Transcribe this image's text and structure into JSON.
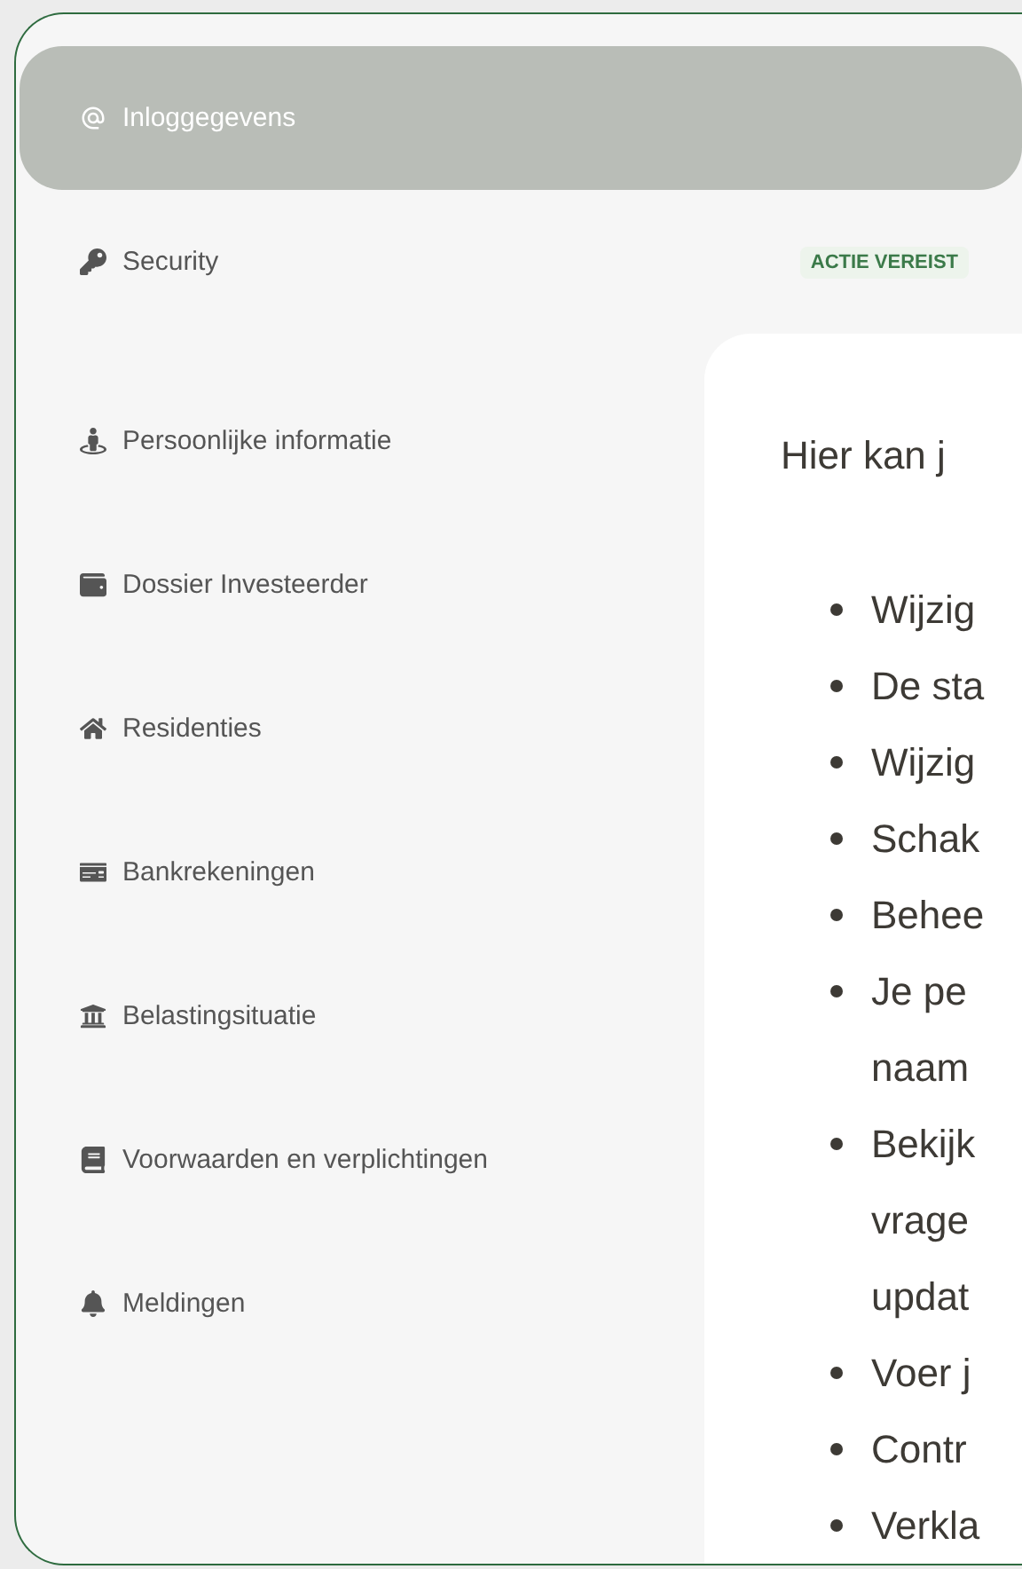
{
  "sidebar": {
    "items": [
      {
        "label": "Inloggegevens",
        "selected": true
      },
      {
        "label": "Security",
        "selected": false,
        "badge": "ACTIE VEREIST"
      },
      {
        "label": "Persoonlijke informatie",
        "selected": false
      },
      {
        "label": "Dossier Investeerder",
        "selected": false
      },
      {
        "label": "Residenties",
        "selected": false
      },
      {
        "label": "Bankrekeningen",
        "selected": false
      },
      {
        "label": "Belastingsituatie",
        "selected": false
      },
      {
        "label": "Voorwaarden en verplichtingen",
        "selected": false
      },
      {
        "label": "Meldingen",
        "selected": false
      }
    ]
  },
  "panel": {
    "intro": "Hier kan j",
    "bullets": [
      {
        "lines": [
          "Wijzig"
        ]
      },
      {
        "lines": [
          "De sta"
        ]
      },
      {
        "lines": [
          "Wijzig"
        ]
      },
      {
        "lines": [
          "Schak"
        ]
      },
      {
        "lines": [
          "Behee"
        ]
      },
      {
        "lines": [
          "Je pe",
          "naam"
        ]
      },
      {
        "lines": [
          "Bekijk",
          "vrage",
          "updat"
        ]
      },
      {
        "lines": [
          "Voer j"
        ]
      },
      {
        "lines": [
          "Contr"
        ]
      },
      {
        "lines": [
          "Verkla"
        ]
      }
    ]
  }
}
